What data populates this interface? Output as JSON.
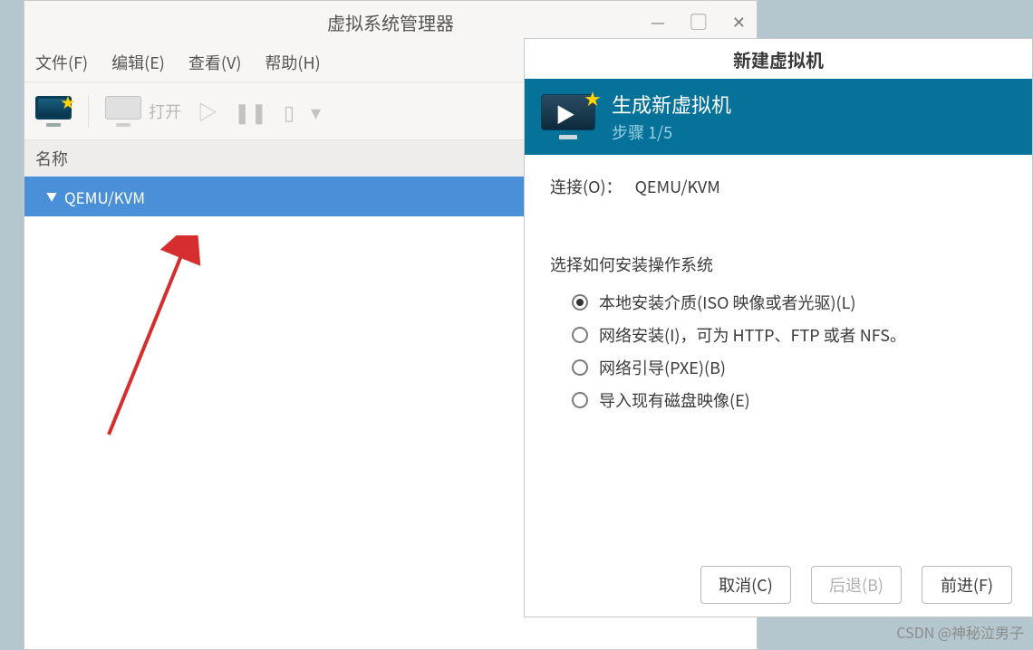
{
  "main": {
    "title": "虚拟系统管理器",
    "menu": {
      "file": "文件(F)",
      "edit": "编辑(E)",
      "view": "查看(V)",
      "help": "帮助(H)"
    },
    "toolbar": {
      "open": "打开"
    },
    "columnHeader": "名称",
    "rows": [
      {
        "label": "QEMU/KVM"
      }
    ]
  },
  "dialog": {
    "title": "新建虚拟机",
    "bannerTitle": "生成新虚拟机",
    "bannerStep": "步骤 1/5",
    "connectionLabel": "连接(O)：",
    "connectionValue": "QEMU/KVM",
    "prompt": "选择如何安装操作系统",
    "options": [
      {
        "label": "本地安装介质(ISO 映像或者光驱)(L)",
        "selected": true
      },
      {
        "label": "网络安装(I)，可为 HTTP、FTP 或者 NFS。",
        "selected": false
      },
      {
        "label": "网络引导(PXE)(B)",
        "selected": false
      },
      {
        "label": "导入现有磁盘映像(E)",
        "selected": false
      }
    ],
    "buttons": {
      "cancel": "取消(C)",
      "back": "后退(B)",
      "next": "前进(F)"
    }
  },
  "watermark": "CSDN @神秘泣男子"
}
